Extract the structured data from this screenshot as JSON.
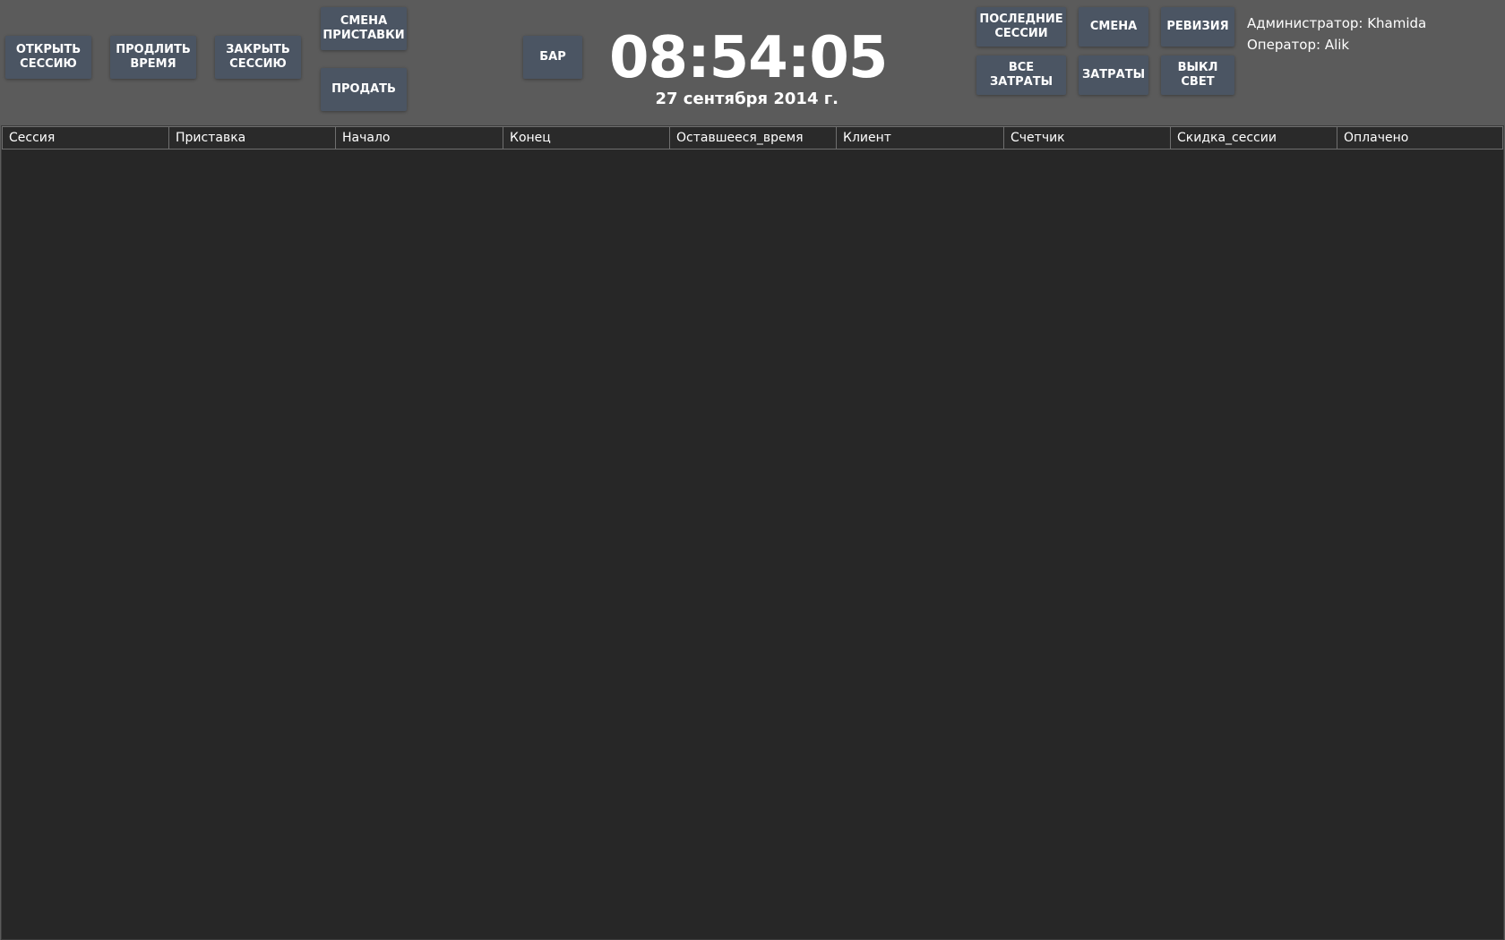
{
  "toolbar": {
    "open_session": "ОТКРЫТЬ\nСЕССИЮ",
    "extend_time": "ПРОДЛИТЬ\nВРЕМЯ",
    "close_session": "ЗАКРЫТЬ\nСЕССИЮ",
    "change_console": "СМЕНА\nПРИСТАВКИ",
    "sell": "ПРОДАТЬ",
    "bar": "БАР",
    "last_sessions": "ПОСЛЕДНИЕ\nСЕССИИ",
    "shift": "СМЕНА",
    "revision": "РЕВИЗИЯ",
    "all_expenses": "ВСЕ ЗАТРАТЫ",
    "expenses": "ЗАТРАТЫ",
    "lights_off": "ВЫКЛ\nСВЕТ"
  },
  "clock": {
    "time": "08:54:05",
    "date": "27 сентября 2014 г."
  },
  "user": {
    "admin": "Администратор: Khamida",
    "operator": "Оператор: Alik"
  },
  "table": {
    "columns": [
      "Сессия",
      "Приставка",
      "Начало",
      "Конец",
      "Оставшееся_время",
      "Клиент",
      "Счетчик",
      "Скидка_сессии",
      "Оплачено"
    ],
    "rows": []
  },
  "colors": {
    "topbar_bg": "#5b5b5b",
    "button_bg": "#4b5563",
    "grid_bg": "#272727",
    "text": "#ffffff"
  }
}
